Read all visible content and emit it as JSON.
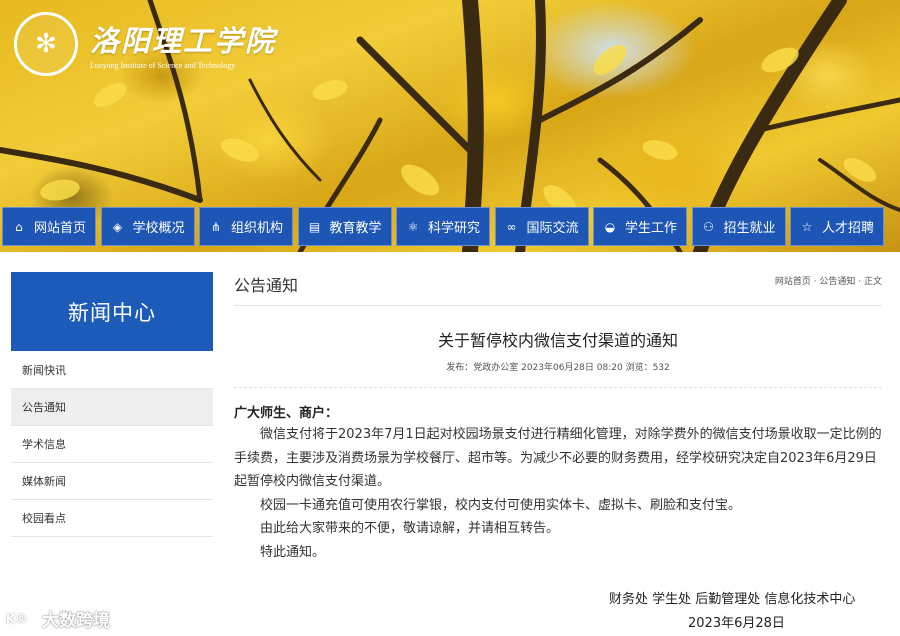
{
  "header": {
    "school_name_cn": "洛阳理工学院",
    "school_name_en": "Luoyang Institute of Science and Technology",
    "seal_glyph": "✻"
  },
  "nav": {
    "items": [
      {
        "label": "网站首页",
        "icon": "home-icon",
        "glyph": "⌂"
      },
      {
        "label": "学校概况",
        "icon": "layers-icon",
        "glyph": "◈"
      },
      {
        "label": "组织机构",
        "icon": "share-icon",
        "glyph": "⋔"
      },
      {
        "label": "教育教学",
        "icon": "book-icon",
        "glyph": "▤"
      },
      {
        "label": "科学研究",
        "icon": "atom-icon",
        "glyph": "⚛"
      },
      {
        "label": "国际交流",
        "icon": "link-icon",
        "glyph": "∞"
      },
      {
        "label": "学生工作",
        "icon": "graduation-cap-icon",
        "glyph": "◒"
      },
      {
        "label": "招生就业",
        "icon": "users-icon",
        "glyph": "⚇"
      },
      {
        "label": "人才招聘",
        "icon": "star-icon",
        "glyph": "☆"
      }
    ],
    "bg_color": "#1e56b6"
  },
  "sidebar": {
    "title": "新闻中心",
    "items": [
      {
        "label": "新闻快讯"
      },
      {
        "label": "公告通知"
      },
      {
        "label": "学术信息"
      },
      {
        "label": "媒体新闻"
      },
      {
        "label": "校园看点"
      }
    ],
    "active_index": 1,
    "header_color": "#1c5bb7"
  },
  "main": {
    "section_title": "公告通知",
    "breadcrumb": "网站首页 · 公告通知 · 正文",
    "article": {
      "title": "关于暂停校内微信支付渠道的通知",
      "meta": "发布：党政办公室   2023年06月28日 08:20   浏览：532",
      "greeting": "广大师生、商户：",
      "paragraphs": [
        "微信支付将于2023年7月1日起对校园场景支付进行精细化管理，对除学费外的微信支付场景收取一定比例的手续费，主要涉及消费场景为学校餐厅、超市等。为减少不必要的财务费用，经学校研究决定自2023年6月29日起暂停校内微信支付渠道。",
        "校园一卡通充值可使用农行掌银，校内支付可使用实体卡、虚拟卡、刷脸和支付宝。",
        "由此给大家带来的不便，敬请谅解，并请相互转告。",
        "特此通知。"
      ],
      "signature": "财务处 学生处 后勤管理处 信息化技术中心",
      "date": "2023年6月28日"
    }
  },
  "watermark": {
    "logo": "K©",
    "text": "大数跨境"
  }
}
